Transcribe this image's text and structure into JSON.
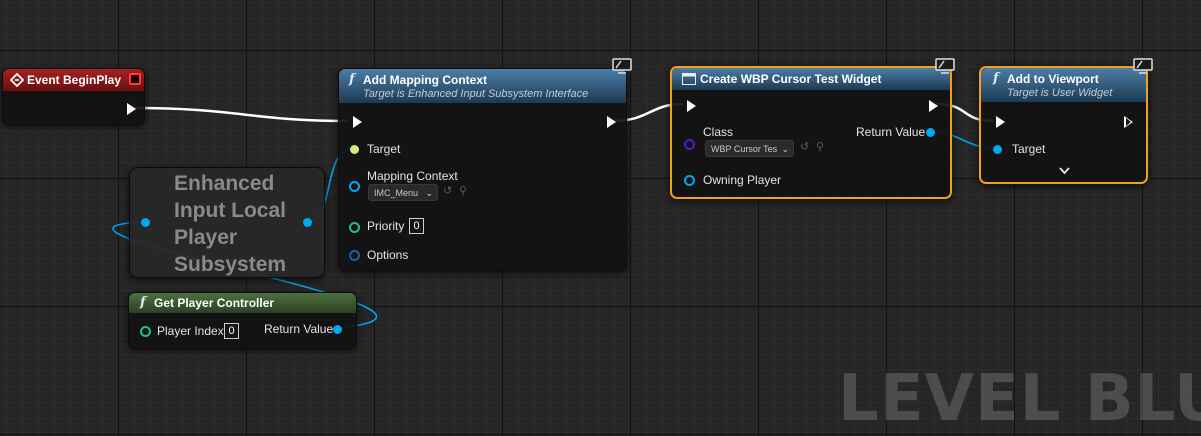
{
  "watermark": "LEVEL BLUEPR",
  "nodes": {
    "event_begin_play": {
      "title": "Event BeginPlay"
    },
    "enhanced_input": {
      "title": "Enhanced Input Local Player Subsystem",
      "title_lines": [
        "Enhanced",
        "Input Local",
        "Player",
        "Subsystem"
      ]
    },
    "get_player_controller": {
      "title": "Get Player Controller",
      "player_index_label": "Player Index",
      "player_index_value": "0",
      "return_label": "Return Value"
    },
    "add_mapping_context": {
      "title": "Add Mapping Context",
      "subtitle": "Target is Enhanced Input Subsystem Interface",
      "target_label": "Target",
      "mapping_label": "Mapping Context",
      "mapping_value": "IMC_Menu",
      "priority_label": "Priority",
      "priority_value": "0",
      "options_label": "Options"
    },
    "create_widget": {
      "title": "Create WBP Cursor Test Widget",
      "class_label": "Class",
      "class_value": "WBP Cursor Tes",
      "return_label": "Return Value",
      "owning_label": "Owning Player"
    },
    "add_to_viewport": {
      "title": "Add to Viewport",
      "subtitle": "Target is User Widget",
      "target_label": "Target"
    }
  },
  "icons": {
    "event_icon": "event-diamond",
    "function_icon": "function-f",
    "widget_icon": "widget-window",
    "net_icon": "network-monitor",
    "dropdown_icon": "chevron-down",
    "browse_icon": "arrow-left-circle",
    "search_icon": "magnifier"
  },
  "colors": {
    "exec": "#ffffff",
    "object_pin": "#00a8f4",
    "target_pin": "#d8e87a",
    "struct_pin": "#1fbf8f",
    "class_pin": "#5b17c7",
    "selection": "#f2a01a",
    "event_header": "#8e1b1b",
    "function_header": "#3d6d93",
    "pure_header": "#3e5d34",
    "options_pin": "#1a5fb0"
  }
}
